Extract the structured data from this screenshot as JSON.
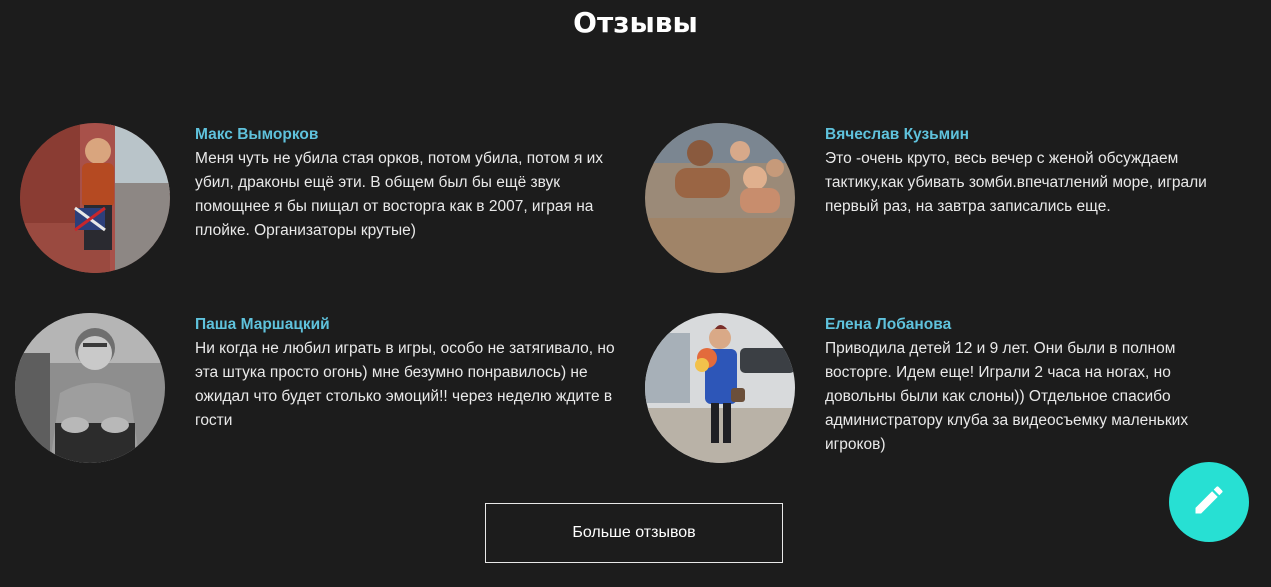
{
  "section": {
    "title": "Отзывы"
  },
  "reviews": [
    {
      "name": "Макс Выморков",
      "text": "Меня чуть не убила стая орков, потом убила, потом я их убил, драконы ещё эти. В общем был бы ещё звук помощнее я бы пищал от восторга как в 2007, играя на плойке. Организаторы крутые)",
      "avatar_icon": "user-photo"
    },
    {
      "name": "Вячеслав Кузьмин",
      "text": "Это -очень круто, весь вечер с женой обсуждаем тактику,как убивать зомби.впечатлений море, играли первый раз, на завтра записались еще.",
      "avatar_icon": "user-photo"
    },
    {
      "name": "Паша Маршацкий",
      "text": "Ни когда не любил играть в игры, особо не затягивало, но эта штука просто огонь) мне безумно понравилось) не ожидал что будет столько эмоций!! через неделю ждите в гости",
      "avatar_icon": "user-photo"
    },
    {
      "name": "Елена Лобанова",
      "text": "Приводила детей 12 и 9 лет. Они были в полном восторге. Идем еще! Играли 2 часа на ногах, но довольны были как слоны)) Отдельное спасибо администратору клуба за видеосъемку маленьких игроков)",
      "avatar_icon": "user-photo"
    }
  ],
  "more_button": {
    "label": "Больше отзывов"
  },
  "fab": {
    "icon": "pencil-icon"
  },
  "colors": {
    "background": "#1c1c1c",
    "name_accent": "#5fc2dc",
    "fab": "#27e0d3"
  }
}
